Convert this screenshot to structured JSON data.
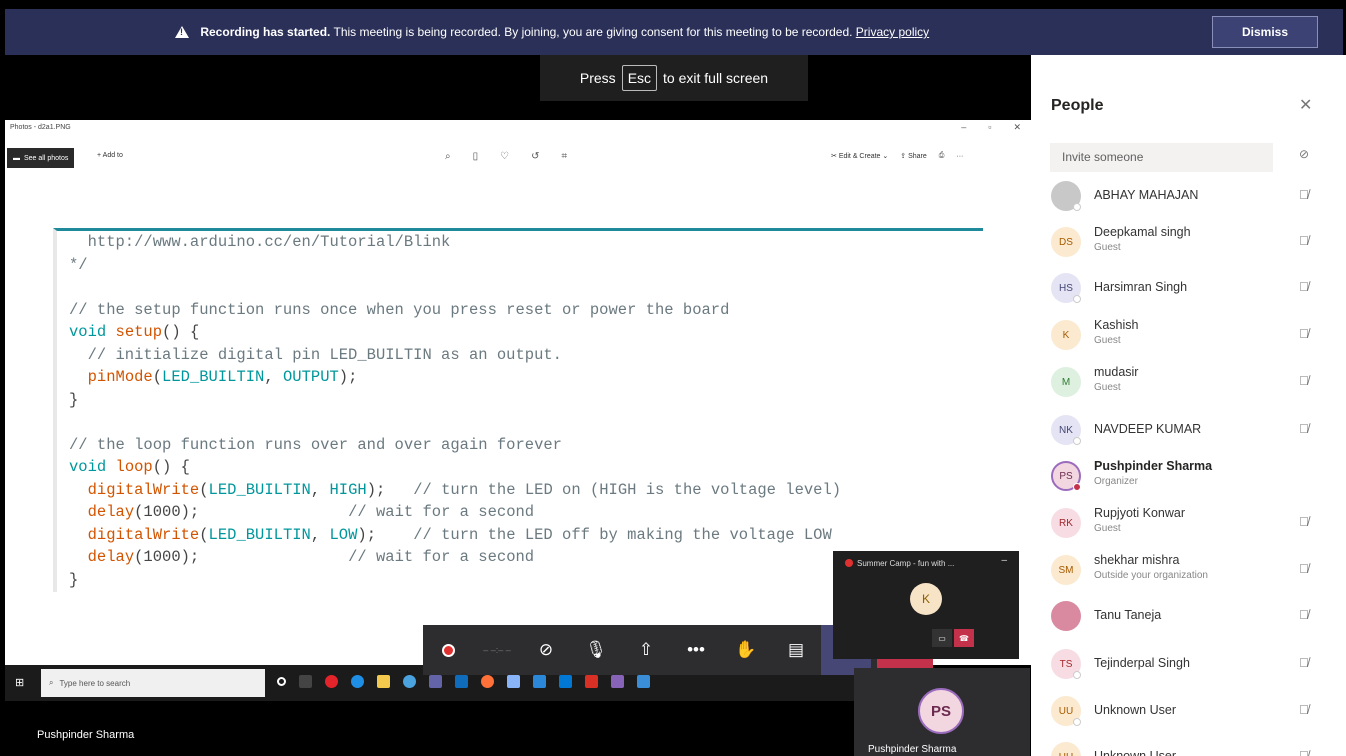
{
  "banner": {
    "bold": "Recording has started.",
    "text": "This meeting is being recorded. By joining, you are giving consent for this meeting to be recorded.",
    "link": "Privacy policy",
    "dismiss": "Dismiss"
  },
  "esc_hint": {
    "pre": "Press",
    "key": "Esc",
    "post": "to exit full screen"
  },
  "photos": {
    "title": "Photos - d2a1.PNG",
    "see_all": "See all photos",
    "add_to": "Add to",
    "edit_create": "Edit & Create",
    "share": "Share",
    "code_lines": [
      [
        {
          "t": "  http://www.arduino.cc/en/Tutorial/Blink",
          "c": "cm"
        }
      ],
      [
        {
          "t": "*/",
          "c": "cm"
        }
      ],
      [
        {
          "t": "",
          "c": ""
        }
      ],
      [
        {
          "t": "// the setup function runs once when you press reset or power the board",
          "c": "cm"
        }
      ],
      [
        {
          "t": "void",
          "c": "kw"
        },
        {
          "t": " ",
          "c": ""
        },
        {
          "t": "setup",
          "c": "fn"
        },
        {
          "t": "() {",
          "c": ""
        }
      ],
      [
        {
          "t": "  // initialize digital pin LED_BUILTIN as an output.",
          "c": "cm"
        }
      ],
      [
        {
          "t": "  ",
          "c": ""
        },
        {
          "t": "pinMode",
          "c": "fn"
        },
        {
          "t": "(",
          "c": ""
        },
        {
          "t": "LED_BUILTIN",
          "c": "cn"
        },
        {
          "t": ", ",
          "c": ""
        },
        {
          "t": "OUTPUT",
          "c": "cn"
        },
        {
          "t": ");",
          "c": ""
        }
      ],
      [
        {
          "t": "}",
          "c": ""
        }
      ],
      [
        {
          "t": "",
          "c": ""
        }
      ],
      [
        {
          "t": "// the loop function runs over and over again forever",
          "c": "cm"
        }
      ],
      [
        {
          "t": "void",
          "c": "kw"
        },
        {
          "t": " ",
          "c": ""
        },
        {
          "t": "loop",
          "c": "fn"
        },
        {
          "t": "() {",
          "c": ""
        }
      ],
      [
        {
          "t": "  ",
          "c": ""
        },
        {
          "t": "digitalWrite",
          "c": "fn"
        },
        {
          "t": "(",
          "c": ""
        },
        {
          "t": "LED_BUILTIN",
          "c": "cn"
        },
        {
          "t": ", ",
          "c": ""
        },
        {
          "t": "HIGH",
          "c": "cn"
        },
        {
          "t": ");   ",
          "c": ""
        },
        {
          "t": "// turn the LED on (HIGH is the voltage level)",
          "c": "cm"
        }
      ],
      [
        {
          "t": "  ",
          "c": ""
        },
        {
          "t": "delay",
          "c": "fn"
        },
        {
          "t": "(1000);                ",
          "c": ""
        },
        {
          "t": "// wait for a second",
          "c": "cm"
        }
      ],
      [
        {
          "t": "  ",
          "c": ""
        },
        {
          "t": "digitalWrite",
          "c": "fn"
        },
        {
          "t": "(",
          "c": ""
        },
        {
          "t": "LED_BUILTIN",
          "c": "cn"
        },
        {
          "t": ", ",
          "c": ""
        },
        {
          "t": "LOW",
          "c": "cn"
        },
        {
          "t": ");    ",
          "c": ""
        },
        {
          "t": "// turn the LED off by making the voltage LOW",
          "c": "cm"
        }
      ],
      [
        {
          "t": "  ",
          "c": ""
        },
        {
          "t": "delay",
          "c": "fn"
        },
        {
          "t": "(1000);                ",
          "c": ""
        },
        {
          "t": "// wait for a second",
          "c": "cm"
        }
      ],
      [
        {
          "t": "}",
          "c": ""
        }
      ]
    ]
  },
  "taskbar": {
    "search_placeholder": "Type here to search"
  },
  "bottom_name": "Pushpinder Sharma",
  "mini_window": {
    "title": "Summer Camp - fun with ...",
    "avatar": "K"
  },
  "self_view": {
    "initials": "PS",
    "name": "Pushpinder Sharma"
  },
  "panel": {
    "title": "People",
    "invite_placeholder": "Invite someone",
    "people": [
      {
        "name": "ABHAY MAHAJAN",
        "role": "",
        "initials": "",
        "bg": "#c8c8c8",
        "fg": "#fff",
        "status": "away",
        "bold": false
      },
      {
        "name": "Deepkamal singh",
        "role": "Guest",
        "initials": "DS",
        "bg": "#fbe9d0",
        "fg": "#a55b00",
        "status": "",
        "bold": false
      },
      {
        "name": "Harsimran Singh",
        "role": "",
        "initials": "HS",
        "bg": "#e4e4f5",
        "fg": "#464775",
        "status": "away",
        "bold": false
      },
      {
        "name": "Kashish",
        "role": "Guest",
        "initials": "K",
        "bg": "#fbe9d0",
        "fg": "#a55b00",
        "status": "",
        "bold": false
      },
      {
        "name": "mudasir",
        "role": "Guest",
        "initials": "M",
        "bg": "#def0e0",
        "fg": "#2e7d32",
        "status": "",
        "bold": false
      },
      {
        "name": "NAVDEEP KUMAR",
        "role": "",
        "initials": "NK",
        "bg": "#e4e4f5",
        "fg": "#464775",
        "status": "away",
        "bold": false
      },
      {
        "name": "Pushpinder Sharma",
        "role": "Organizer",
        "initials": "PS",
        "bg": "#f2d7e1",
        "fg": "#6b2b4f",
        "status": "busy",
        "bold": true
      },
      {
        "name": "Rupjyoti Konwar",
        "role": "Guest",
        "initials": "RK",
        "bg": "#f7dde3",
        "fg": "#a4262c",
        "status": "",
        "bold": false
      },
      {
        "name": "shekhar mishra",
        "role": "Outside your organization",
        "initials": "SM",
        "bg": "#fbe9d0",
        "fg": "#a55b00",
        "status": "",
        "bold": false
      },
      {
        "name": "Tanu Taneja",
        "role": "",
        "initials": "",
        "bg": "#d98aa0",
        "fg": "#fff",
        "status": "",
        "bold": false
      },
      {
        "name": "Tejinderpal Singh",
        "role": "",
        "initials": "TS",
        "bg": "#f7dde3",
        "fg": "#a4262c",
        "status": "away",
        "bold": false
      },
      {
        "name": "Unknown User",
        "role": "",
        "initials": "UU",
        "bg": "#fbe9d0",
        "fg": "#a55b00",
        "status": "away",
        "bold": false
      },
      {
        "name": "Unknown User",
        "role": "",
        "initials": "UU",
        "bg": "#fbe9d0",
        "fg": "#a55b00",
        "status": "",
        "bold": false
      }
    ]
  }
}
